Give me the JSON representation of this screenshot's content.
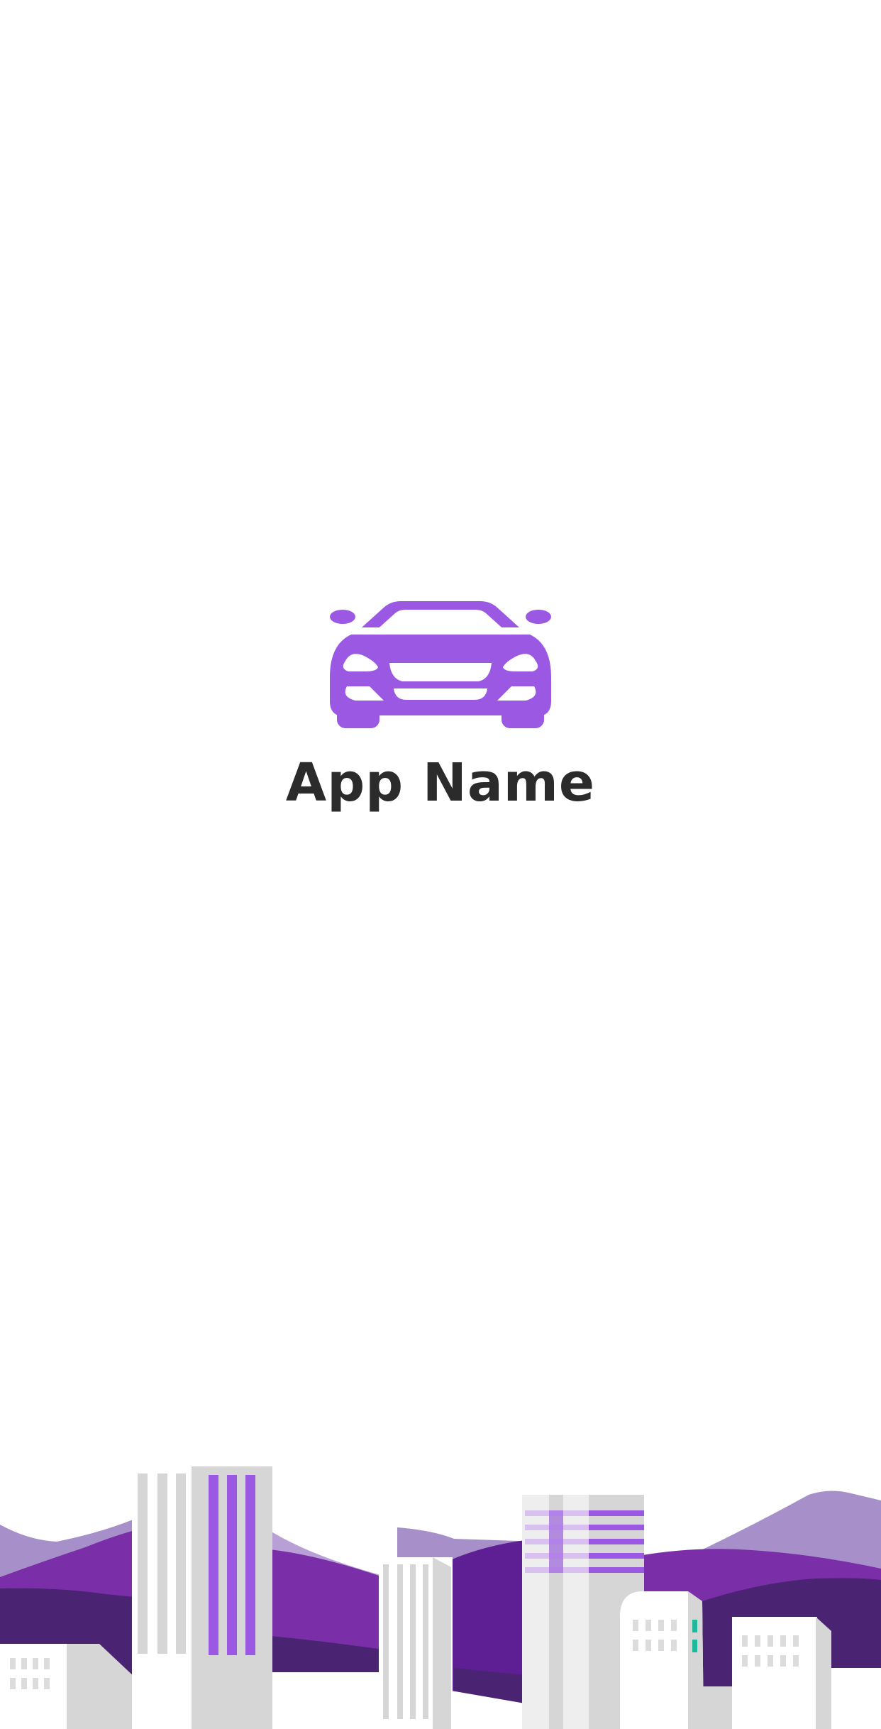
{
  "app": {
    "name": "App Name"
  },
  "icons": {
    "logo": "car-front-icon"
  },
  "colors": {
    "brand_purple": "#9b59e3",
    "text_dark": "#2b2b2b",
    "hill_light": "#a78fc9",
    "hill_mid": "#7a2fa8",
    "hill_dark": "#4a2473",
    "building_grey": "#d6d6d6",
    "accent_teal": "#1fb89a"
  }
}
